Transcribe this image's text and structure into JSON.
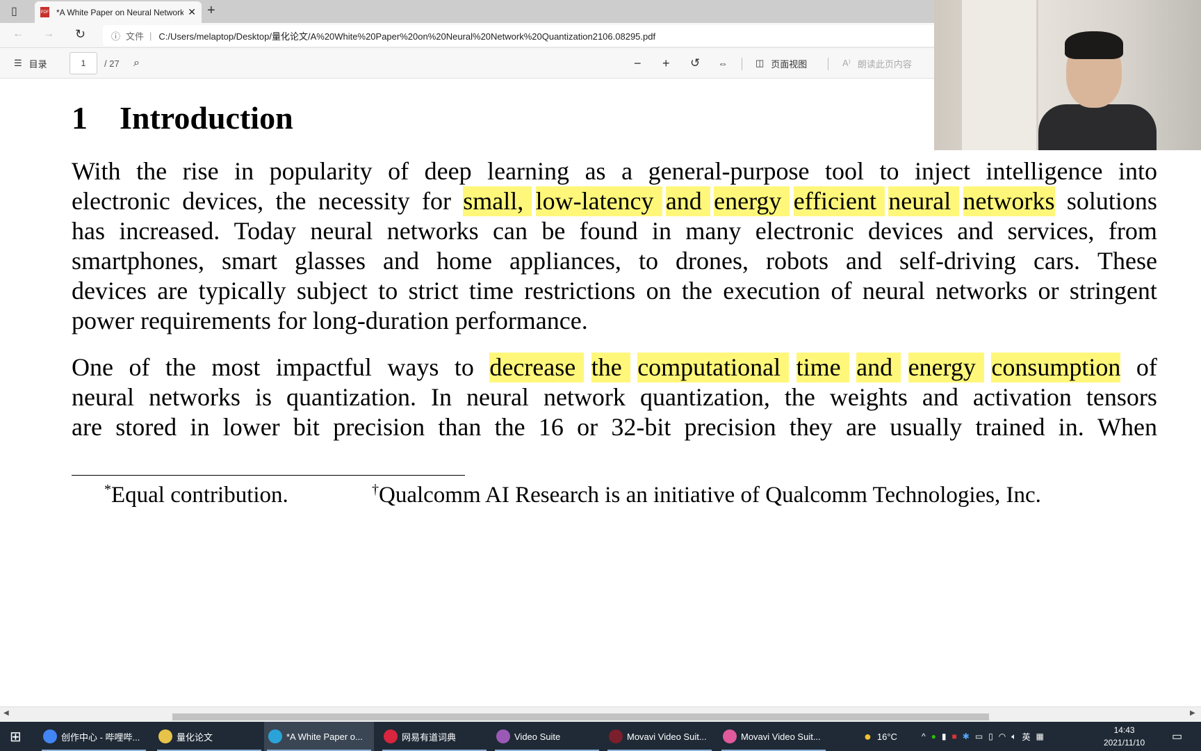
{
  "browser": {
    "tab_title": "*A White Paper on Neural Network Quantization",
    "tab_icon": "pdf-icon",
    "address_label": "文件",
    "url": "C:/Users/melaptop/Desktop/量化论文/A%20White%20Paper%20on%20Neural%20Network%20Quantization2106.08295.pdf"
  },
  "pdf_toolbar": {
    "toc_label": "目录",
    "page_current": "1",
    "page_total": "/ 27",
    "page_view_label": "页面视图",
    "read_aloud_label": "朗读此页内容"
  },
  "document": {
    "section_number": "1",
    "section_title": "Introduction",
    "highlight_color": "#fff77a",
    "paragraphs": [
      [
        [
          {
            "t": "With the rise in popularity of deep learning as a general-purpose tool to inject intelligence into"
          }
        ],
        [
          {
            "t": "electronic devices, the necessity for "
          },
          {
            "t": "small, low-latency and energy efficient neural networks",
            "hl": true
          },
          {
            "t": " solutions"
          }
        ],
        [
          {
            "t": "has increased. Today neural networks can be found in many electronic devices and services, from"
          }
        ],
        [
          {
            "t": "smartphones, smart glasses and home appliances, to drones, robots and self-driving cars. These"
          }
        ],
        [
          {
            "t": "devices are typically subject to strict time restrictions on the execution of neural networks or stringent"
          }
        ],
        [
          {
            "t": "power requirements for long-duration performance."
          }
        ]
      ],
      [
        [
          {
            "t": "One of the most impactful ways to "
          },
          {
            "t": "decrease the computational time and energy consumption",
            "hl": true
          },
          {
            "t": " of"
          }
        ],
        [
          {
            "t": "neural networks is quantization. In neural network quantization, the weights and activation tensors"
          }
        ],
        [
          {
            "t": "are stored in lower bit precision than the 16 or 32-bit precision they are usually trained in. When"
          }
        ]
      ]
    ],
    "footnote1_mark": "*",
    "footnote1": "Equal contribution.",
    "footnote2_mark": "†",
    "footnote2": "Qualcomm AI Research is an initiative of Qualcomm Technologies, Inc."
  },
  "taskbar": {
    "items": [
      {
        "label": "创作中心 - 哔哩哔...",
        "color": "#4285f4"
      },
      {
        "label": "量化论文",
        "color": "#e8c34a"
      },
      {
        "label": "*A White Paper o...",
        "color": "#2aa3d8"
      },
      {
        "label": "网易有道词典",
        "color": "#d7263d"
      },
      {
        "label": "Video Suite",
        "color": "#9b59b6"
      },
      {
        "label": "Movavi Video Suit...",
        "color": "#7a1f2b"
      },
      {
        "label": "Movavi Video Suit...",
        "color": "#e05a9c"
      }
    ],
    "weather": "16°C",
    "ime": "英",
    "time": "14:43",
    "date": "2021/11/10"
  }
}
